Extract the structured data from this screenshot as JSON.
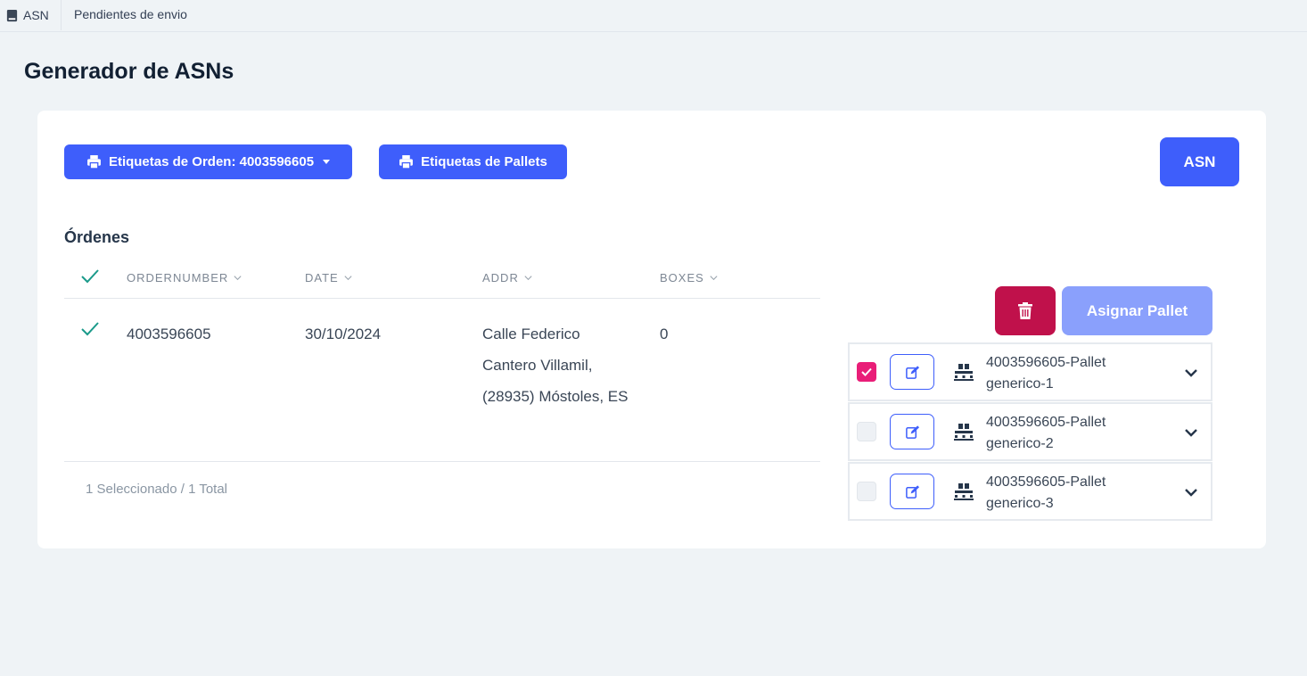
{
  "breadcrumb": {
    "app": "ASN",
    "current": "Pendientes de envio"
  },
  "page": {
    "title": "Generador de ASNs"
  },
  "toolbar": {
    "order_labels_button": "Etiquetas de Orden: 4003596605",
    "pallet_labels_button": "Etiquetas de Pallets",
    "asn_button": "ASN"
  },
  "orders": {
    "title": "Órdenes",
    "columns": [
      "ORDERNUMBER",
      "DATE",
      "ADDR",
      "BOXES"
    ],
    "rows": [
      {
        "selected": true,
        "ordernumber": "4003596605",
        "date": "30/10/2024",
        "addr": "Calle Federico Cantero Villamil, (28935) Móstoles, ES",
        "boxes": "0"
      }
    ],
    "footer": "1 Seleccionado / 1 Total"
  },
  "pallets": {
    "assign_button": "Asignar Pallet",
    "items": [
      {
        "name": "4003596605-Pallet generico-1",
        "checked": true
      },
      {
        "name": "4003596605-Pallet generico-2",
        "checked": false
      },
      {
        "name": "4003596605-Pallet generico-3",
        "checked": false
      }
    ]
  },
  "colors": {
    "primary": "#3e5efb",
    "primary_disabled": "#8aa0fc",
    "danger": "#c0114b",
    "checkbox_on": "#e91e78",
    "check_teal": "#1a9a8a"
  },
  "icons": {
    "breadcrumb": "book-icon",
    "order_labels": "printer-icon",
    "pallet_labels": "printer-icon",
    "delete": "trash-icon",
    "edit": "edit-icon",
    "pallet": "pallet-icon",
    "expand": "chevron-down-icon"
  }
}
